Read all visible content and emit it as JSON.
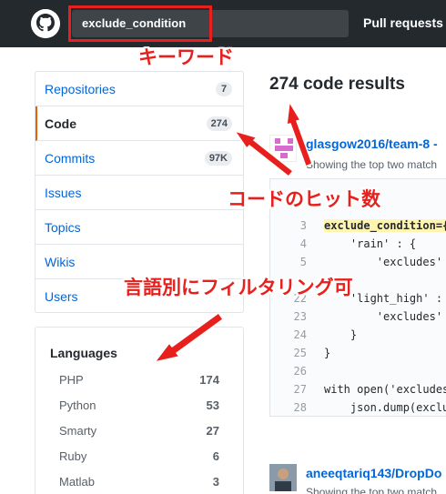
{
  "header": {
    "search_value": "exclude_condition",
    "nav_pull_requests": "Pull requests"
  },
  "sidebar": {
    "items": [
      {
        "label": "Repositories",
        "count": "7"
      },
      {
        "label": "Code",
        "count": "274",
        "selected": true
      },
      {
        "label": "Commits",
        "count": "97K"
      },
      {
        "label": "Issues",
        "count": ""
      },
      {
        "label": "Topics",
        "count": ""
      },
      {
        "label": "Wikis",
        "count": ""
      },
      {
        "label": "Users",
        "count": ""
      }
    ]
  },
  "languages": {
    "title": "Languages",
    "items": [
      {
        "name": "PHP",
        "count": "174"
      },
      {
        "name": "Python",
        "count": "53"
      },
      {
        "name": "Smarty",
        "count": "27"
      },
      {
        "name": "Ruby",
        "count": "6"
      },
      {
        "name": "Matlab",
        "count": "3"
      }
    ]
  },
  "results": {
    "title": "274 code results",
    "first": {
      "repo": "glasgow2016/team-8 -",
      "match_text": "Showing the top two match",
      "code_lines": [
        {
          "ln": "3",
          "code": "exclude_condition={"
        },
        {
          "ln": "4",
          "code": "    'rain' : {"
        },
        {
          "ln": "5",
          "code": "        'excludes'"
        },
        {
          "ln": "22",
          "code": "    'light_high' :"
        },
        {
          "ln": "23",
          "code": "        'excludes'"
        },
        {
          "ln": "24",
          "code": "    }"
        },
        {
          "ln": "25",
          "code": "}"
        },
        {
          "ln": "26",
          "code": ""
        },
        {
          "ln": "27",
          "code": "with open('excludes"
        },
        {
          "ln": "28",
          "code": "    json.dump(exclu"
        }
      ]
    },
    "second": {
      "repo": "aneeqtariq143/DropDo",
      "match_text": "Showing the top two match"
    }
  },
  "annotations": {
    "keyword": "キーワード",
    "hit_count": "コードのヒット数",
    "filter": "言語別にフィルタリング可"
  },
  "colors": {
    "header_bg": "#24292e",
    "link": "#0366d6",
    "annotation_red": "#e8201d",
    "selected_accent": "#e36209",
    "highlight": "#fff5b1"
  }
}
